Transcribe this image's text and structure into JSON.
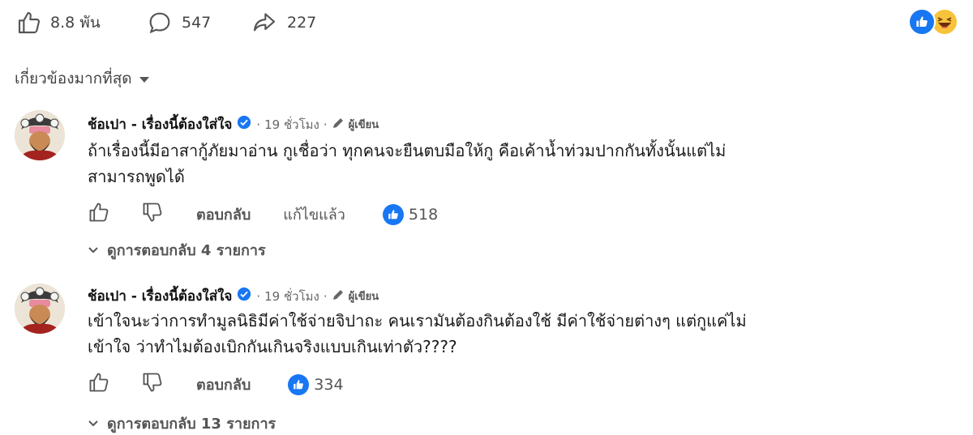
{
  "post_actions": {
    "like_count": "8.8 พัน",
    "comment_count": "547",
    "share_count": "227"
  },
  "sort": {
    "label": "เกี่ยวข้องมากที่สุด"
  },
  "comments": [
    {
      "author": "ช้อเปา - เรื่องนี้ต้องใส่ใจ",
      "time": "19 ชั่วโมง",
      "role": "ผู้เขียน",
      "text_line1": "ถ้าเรื่องนี้มีอาสากู้ภัยมาอ่าน กูเชื่อว่า ทุกคนจะยืนตบมือให้กู คือเค้าน้ำท่วมปากกันทั้งนั้นแต่ไม่",
      "text_line2": "สามารถพูดได้",
      "reply_label": "ตอบกลับ",
      "edited_label": "แก้ไขแล้ว",
      "like_count": "518",
      "replies_label": "ดูการตอบกลับ 4 รายการ"
    },
    {
      "author": "ช้อเปา - เรื่องนี้ต้องใส่ใจ",
      "time": "19 ชั่วโมง",
      "role": "ผู้เขียน",
      "text_line1": "เข้าใจนะว่าการทำมูลนิธิมีค่าใช้จ่ายจิปาถะ คนเรามันต้องกินต้องใช้ มีค่าใช้จ่ายต่างๆ แต่กูแค่ไม่",
      "text_line2": "เข้าใจ ว่าทำไมต้องเบิกกันเกินจริงแบบเกินเท่าตัว????",
      "reply_label": "ตอบกลับ",
      "like_count": "334",
      "replies_label": "ดูการตอบกลับ 13 รายการ"
    }
  ]
}
